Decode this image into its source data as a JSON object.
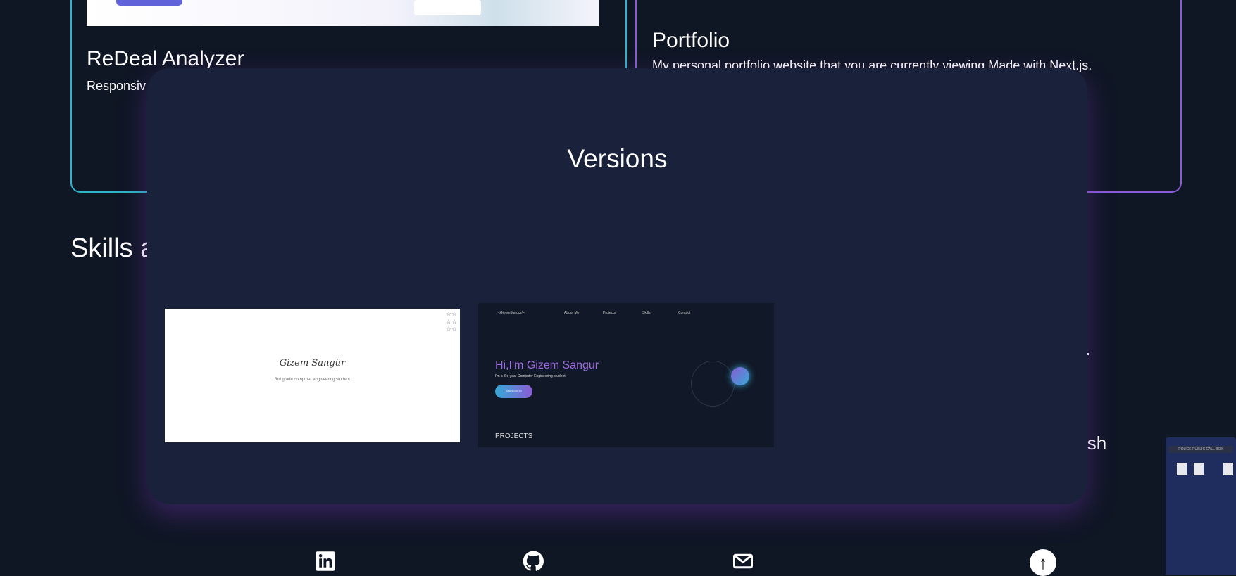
{
  "projects": [
    {
      "title": "ReDeal Analyzer",
      "description": "Responsiv"
    },
    {
      "title": "Portfolio",
      "description": "My personal portfolio website that you are currently viewing Made with Next.js."
    }
  ],
  "skills_heading": "Skills a",
  "partial_text": "ish",
  "modal": {
    "title": "Versions",
    "versions": [
      {
        "name": "Gizem Sangür",
        "subtitle": "3rd grade computer engineering student"
      },
      {
        "logo": "<GizemSangur/>",
        "nav": [
          "About Me",
          "Projects",
          "Skills",
          "Contact"
        ],
        "headline": "Hi,I'm Gizem Sangur",
        "subtitle": "I'm a 3rd year Computer Engineering student.",
        "button": "DOWNLOAD CV",
        "section": "PROJECTS"
      }
    ]
  },
  "tardis_sign": "POLICE PUBLIC CALL BOX",
  "footer": {
    "icons": [
      "linkedin-icon",
      "github-icon",
      "mail-icon",
      "arrow-up-icon"
    ]
  }
}
